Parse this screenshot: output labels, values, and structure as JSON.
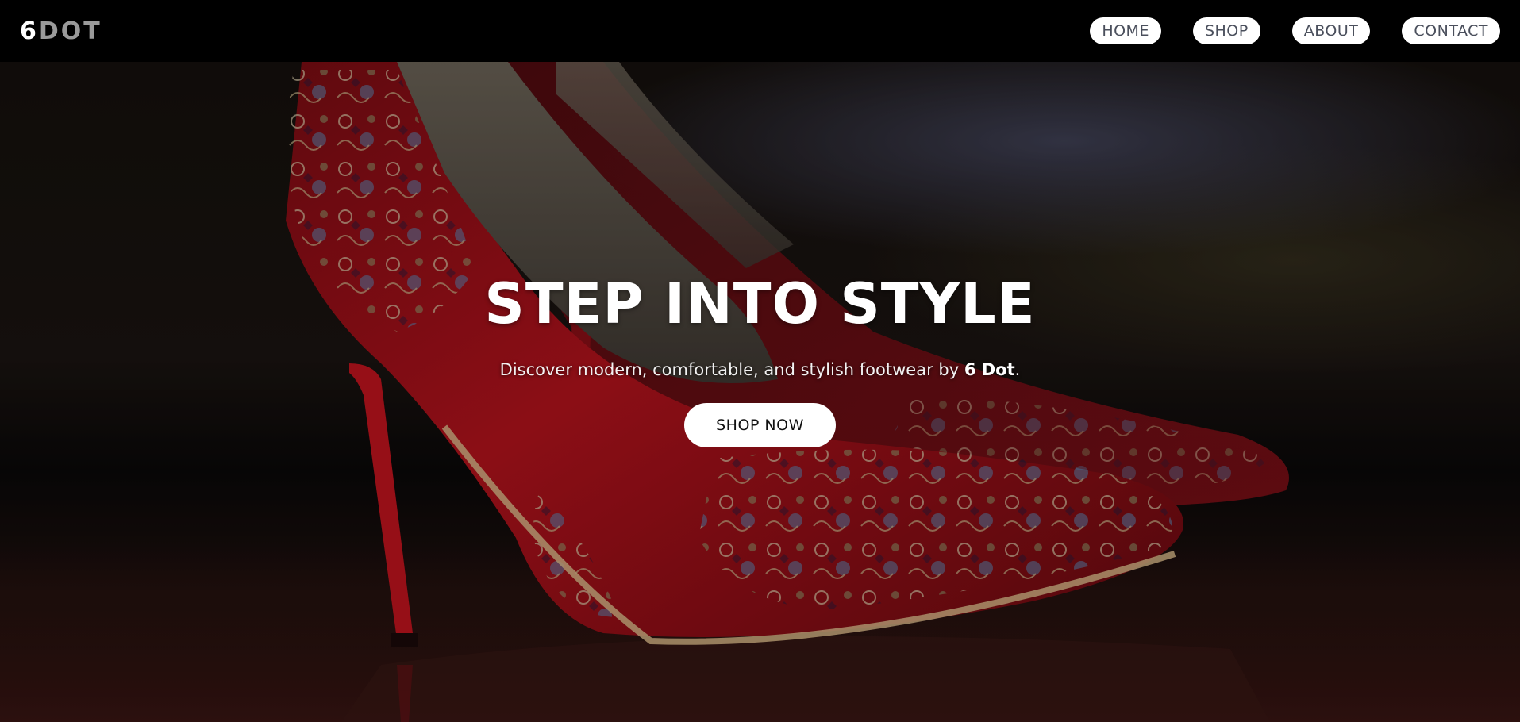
{
  "brand": {
    "logo_num": "6",
    "logo_text": "DOT"
  },
  "nav": {
    "items": [
      {
        "label": "HOME"
      },
      {
        "label": "SHOP"
      },
      {
        "label": "ABOUT"
      },
      {
        "label": "CONTACT"
      }
    ]
  },
  "hero": {
    "title": "STEP INTO STYLE",
    "subtitle_prefix": "Discover modern, comfortable, and stylish footwear by ",
    "subtitle_brand": "6 Dot",
    "subtitle_suffix": ".",
    "cta_label": "SHOP NOW",
    "background_image": "red-embroidered-high-heel-shoes"
  },
  "colors": {
    "nav_bg": "#000000",
    "nav_pill_bg": "#ffffff",
    "nav_pill_text": "#4a4f5c",
    "shoe_red": "#b3121c",
    "cta_bg": "#ffffff"
  }
}
